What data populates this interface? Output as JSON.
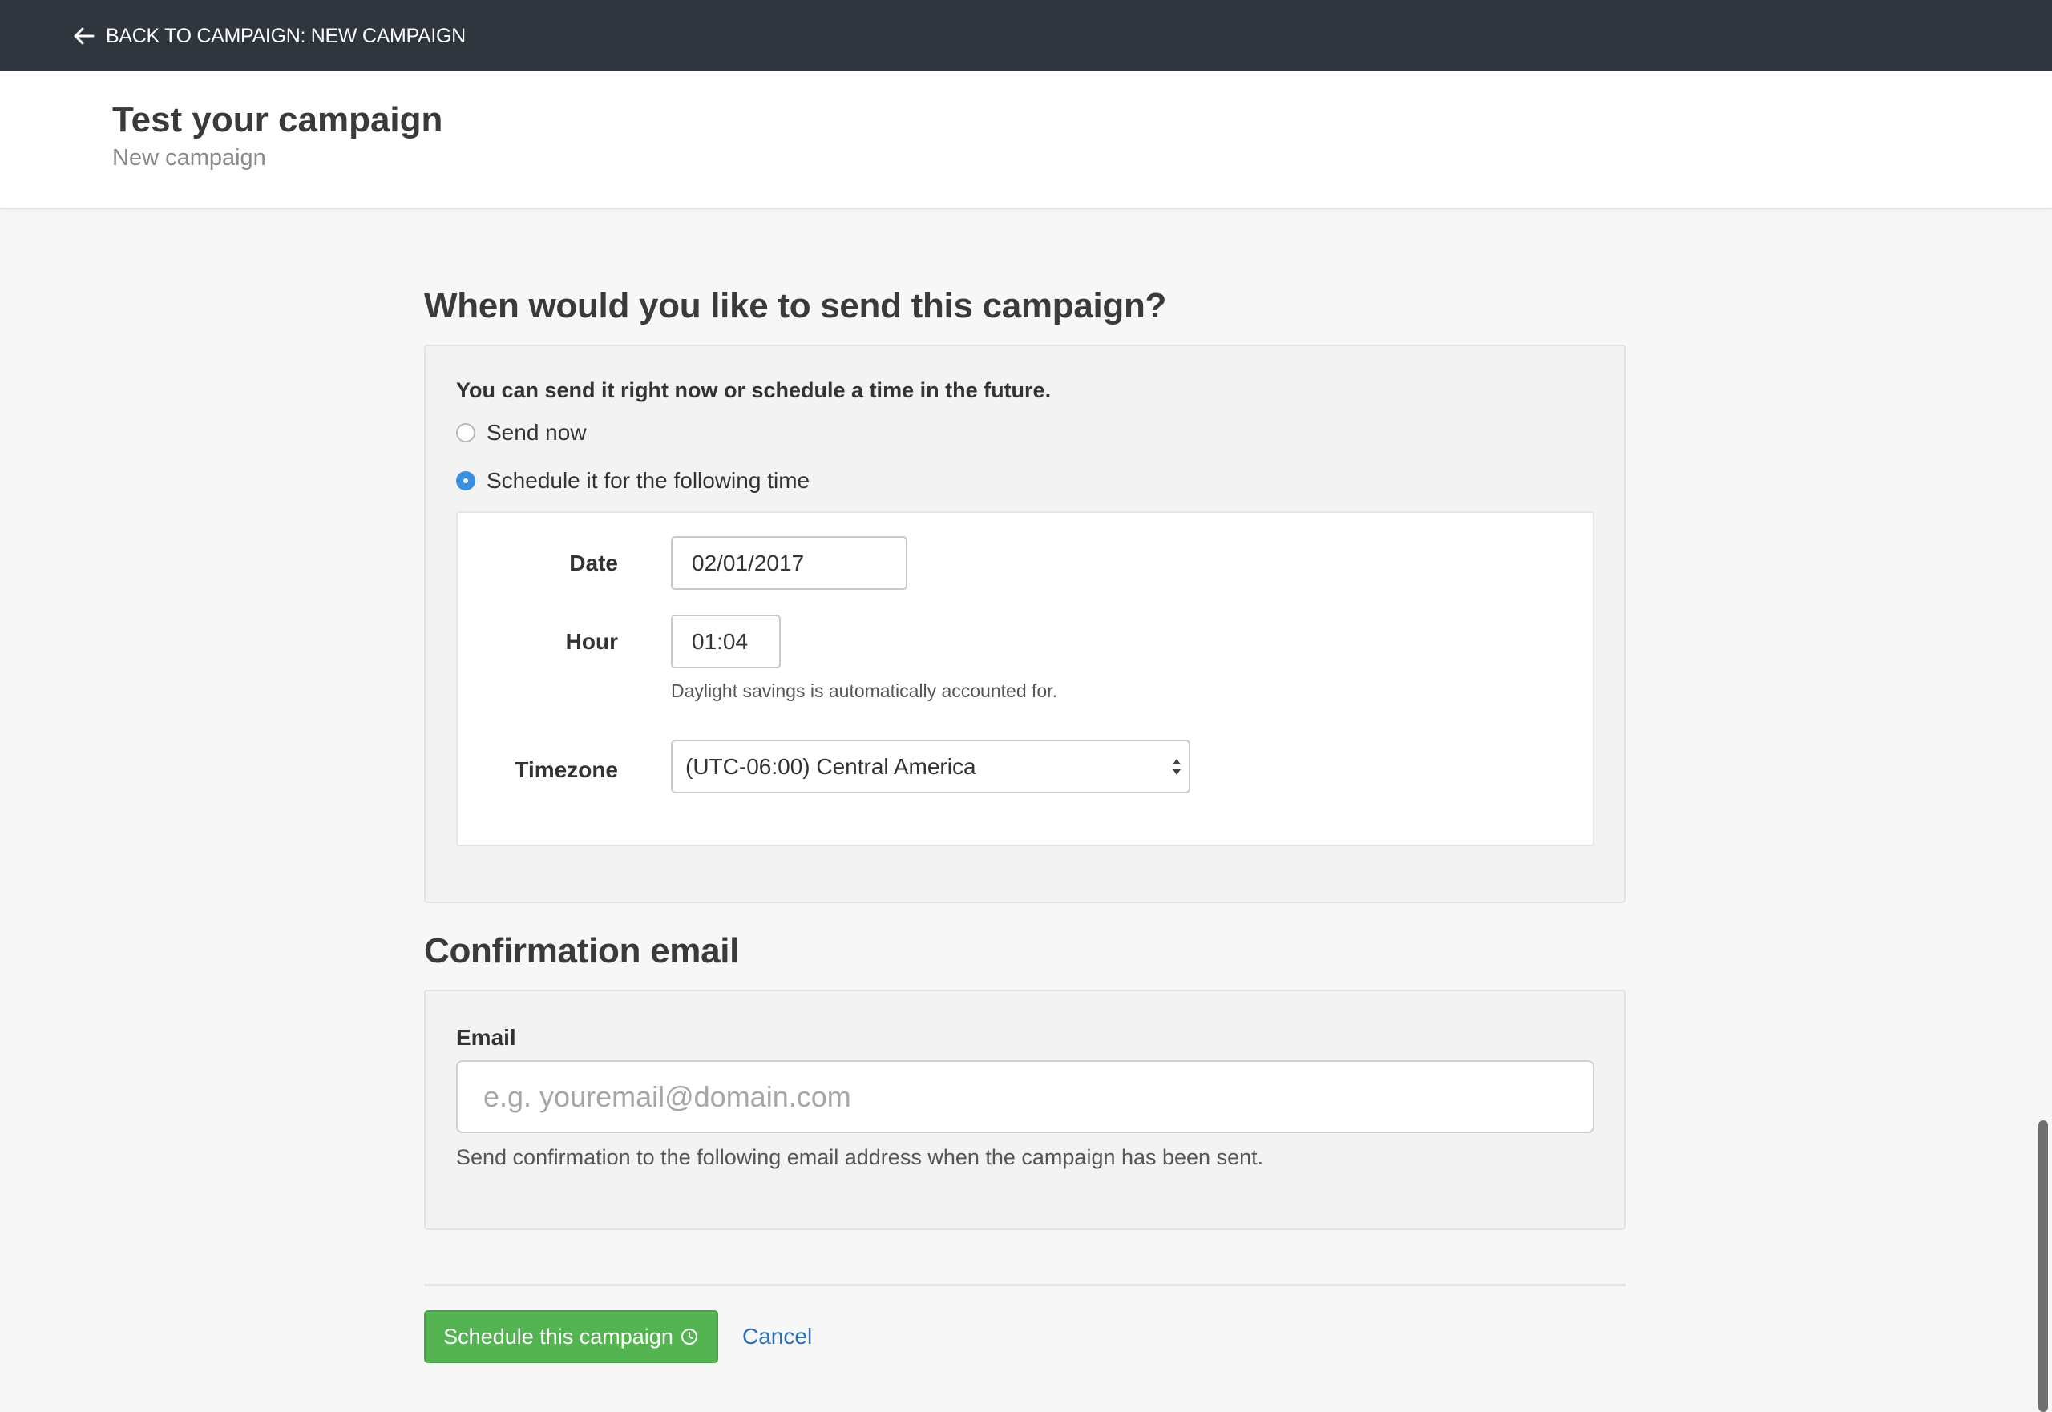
{
  "topbar": {
    "back_label": "BACK TO CAMPAIGN: NEW CAMPAIGN"
  },
  "header": {
    "title": "Test your campaign",
    "subtitle": "New campaign"
  },
  "schedule_section": {
    "title": "When would you like to send this campaign?",
    "intro": "You can send it right now or schedule a time in the future.",
    "options": [
      {
        "label": "Send now",
        "checked": false
      },
      {
        "label": "Schedule it for the following time",
        "checked": true
      }
    ],
    "date_label": "Date",
    "date_value": "02/01/2017",
    "hour_label": "Hour",
    "hour_value": "01:04",
    "hour_help": "Daylight savings is automatically accounted for.",
    "timezone_label": "Timezone",
    "timezone_value": "(UTC-06:00) Central America"
  },
  "confirmation_section": {
    "title": "Confirmation email",
    "email_label": "Email",
    "email_placeholder": "e.g. youremail@domain.com",
    "email_value": "",
    "email_help": "Send confirmation to the following email address when the campaign has been sent."
  },
  "actions": {
    "schedule_label": "Schedule this campaign",
    "cancel_label": "Cancel"
  },
  "colors": {
    "topbar": "#30363e",
    "primary": "#55b452",
    "link": "#2b70b4",
    "radio_checked": "#3a8fe0"
  },
  "icons": {
    "back": "arrow-left-icon",
    "schedule": "clock-icon",
    "select": "select-arrows-icon"
  }
}
